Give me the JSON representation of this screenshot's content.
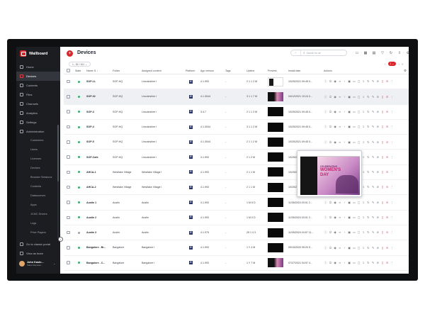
{
  "app": {
    "name": "Wallboard",
    "page_title": "Devices"
  },
  "sidebar": {
    "items": [
      {
        "label": "Home",
        "icon": "home-icon"
      },
      {
        "label": "Devices",
        "icon": "monitor-icon",
        "active": true
      },
      {
        "label": "Contents",
        "icon": "layers-icon"
      },
      {
        "label": "Files",
        "icon": "folder-icon"
      },
      {
        "label": "Channels",
        "icon": "channel-icon"
      },
      {
        "label": "Analytics",
        "icon": "chart-icon"
      },
      {
        "label": "Settings",
        "icon": "gear-icon"
      },
      {
        "label": "Administration",
        "icon": "admin-icon"
      }
    ],
    "sub_items": [
      "Customers",
      "Users",
      "Licenses",
      "Devices",
      "Browser Sessions",
      "Contents",
      "Datasources",
      "Apps",
      "JCMC Drivers",
      "Logs",
      "Price Pagers"
    ],
    "bottom_items": [
      {
        "label": "Go to classic portal",
        "icon": "external-link-icon"
      },
      {
        "label": "View as team",
        "icon": "eye-icon"
      }
    ],
    "user": {
      "name": "John Kasin...",
      "role": "Sales Represe..."
    }
  },
  "header": {
    "search_select": "⌄",
    "search_placeholder": "Search for all",
    "filter_label": "1 - 52 / 101 ⌄",
    "page_badge": "1 ⌄"
  },
  "table": {
    "columns": {
      "state": "State",
      "name": "Name ⇅ ↑",
      "folder": "Folder",
      "content": "Assigned content",
      "platform": "Platform",
      "app": "App version",
      "tags": "Tags",
      "uptime": "Uptime",
      "preview": "Preview",
      "install": "Install date",
      "actions": "Actions"
    },
    "rows": [
      {
        "online": true,
        "name": "SOP-LL",
        "folder": "SOP-HQ",
        "content": "Lincolnshire I",
        "platform": "E",
        "app": "4.1.993",
        "tags": "-",
        "uptime": "2 1 1 2 M",
        "preview": "white",
        "install": "10/25/2021 09:45 0..."
      },
      {
        "online": true,
        "name": "SOP-02",
        "folder": "SOP-HQ",
        "content": "Lincolnshire I",
        "platform": "E",
        "app": "4.1.3044",
        "tags": "-",
        "uptime": "3 1 1 7 M",
        "preview": "pink",
        "install": "04/12/2021 10:24 0...",
        "highlight": true
      },
      {
        "online": true,
        "name": "SOP-3",
        "folder": "SOP-HQ",
        "content": "Lincolnshire I",
        "platform": "E",
        "app": "3.4.7",
        "tags": "-",
        "uptime": "2 1 1 2 M",
        "preview": "dark",
        "install": "10/25/2021 09:45 0..."
      },
      {
        "online": true,
        "name": "SOP-4",
        "folder": "SOP-HQ",
        "content": "Lincolnshire I",
        "platform": "E",
        "app": "4.1.3044",
        "tags": "-",
        "uptime": "3 1 1 2 M",
        "preview": "dark",
        "install": "10/25/2021 09:45 0..."
      },
      {
        "online": true,
        "name": "SOP-5",
        "folder": "SOP-HQ",
        "content": "Lincolnshire I",
        "platform": "E",
        "app": "4.1.3044",
        "tags": "-",
        "uptime": "2 1 1 2 M",
        "preview": "dark",
        "install": "10/25/2021 09:45 0..."
      },
      {
        "online": true,
        "name": "SOP-Cafe",
        "folder": "SOP-HQ",
        "content": "Lincolnshire I",
        "platform": "E",
        "app": "4.1.993",
        "tags": "-",
        "uptime": "2 1 2 M",
        "preview": "dark",
        "install": "10/25/2021 09:45 0..."
      },
      {
        "online": true,
        "name": "AHCA-1",
        "folder": "Westlake Village",
        "content": "Westlake Village I",
        "platform": "E",
        "app": "4.1.993",
        "tags": "-",
        "uptime": "2 1 1 M",
        "preview": "dark",
        "install": "10/25/2021 11:10 33..."
      },
      {
        "online": true,
        "name": "AHCA-2",
        "folder": "Westlake Village",
        "content": "Westlake Village I",
        "platform": "E",
        "app": "4.1.993",
        "tags": "-",
        "uptime": "2 1 1 M",
        "preview": "dark",
        "install": "10/25/2021 12:06 4..."
      },
      {
        "online": true,
        "name": "Austin 1",
        "folder": "Austin",
        "content": "Austin",
        "platform": "E",
        "app": "4.1.993",
        "tags": "-",
        "uptime": "1 M 5 D",
        "preview": "dark",
        "install": "11/05/2024 03:01 2..."
      },
      {
        "online": true,
        "name": "Austin 2",
        "folder": "Austin",
        "content": "Austin",
        "platform": "E",
        "app": "4.1.993",
        "tags": "-",
        "uptime": "1 M 0 D",
        "preview": "dark",
        "install": "11/05/2024 03:01 2..."
      },
      {
        "online": false,
        "name": "Austin 3",
        "folder": "Austin",
        "content": "Austin",
        "platform": "E",
        "app": "4.1.975",
        "tags": "-",
        "uptime": "25 1 4 3",
        "preview": "dark",
        "install": "11/05/2024 04:57 11..."
      },
      {
        "online": true,
        "name": "Bangalore - Br...",
        "folder": "Bangalore",
        "content": "Bangalore I",
        "platform": "E",
        "app": "4.1.993",
        "tags": "-",
        "uptime": "1 Y 4 M",
        "preview": "dark",
        "install": "09/15/2020 05:20 5..."
      },
      {
        "online": true,
        "name": "Bangalore - C...",
        "folder": "Bangalore",
        "content": "Bangalore I",
        "platform": "E",
        "app": "4.1.993",
        "tags": "-",
        "uptime": "1 Y 7 M",
        "preview": "pink",
        "install": "07/27/2021 04:57 4..."
      }
    ]
  },
  "popup": {
    "line1": "CELEBRATING",
    "line2": "WOMEN'S",
    "line3": "DAY"
  },
  "colors": {
    "accent": "#d8262b",
    "sidebar_bg": "#1b1d21",
    "online": "#2fb46a"
  }
}
